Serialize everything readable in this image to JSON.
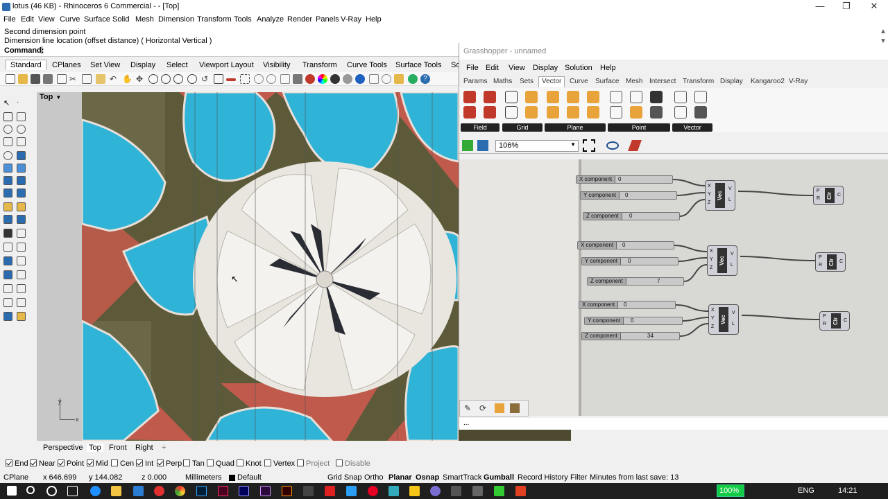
{
  "window": {
    "title": "lotus (46 KB) - Rhinoceros 6 Commercial - - [Top]",
    "minimize": "—",
    "maximize": "❐",
    "close": "✕"
  },
  "menu": [
    "File",
    "Edit",
    "View",
    "Curve",
    "Surface",
    "Solid",
    "Mesh",
    "Dimension",
    "Transform",
    "Tools",
    "Analyze",
    "Render",
    "Panels",
    "V-Ray",
    "Help"
  ],
  "command": {
    "line1": "Second dimension point",
    "line2": "Dimension line location (offset distance) ( Horizontal  Vertical )",
    "prompt": "Command:"
  },
  "command_tabs": [
    "Standard",
    "CPlanes",
    "Set View",
    "Display",
    "Select",
    "Viewport Layout",
    "Visibility",
    "Transform",
    "Curve Tools",
    "Surface Tools",
    "So"
  ],
  "viewport": {
    "label": "Top",
    "axis_x": "x",
    "axis_y": "y"
  },
  "view_tabs": [
    "Perspective",
    "Top",
    "Front",
    "Right"
  ],
  "view_tabs_add": "+",
  "osnap": [
    {
      "label": "End",
      "on": true
    },
    {
      "label": "Near",
      "on": true
    },
    {
      "label": "Point",
      "on": true
    },
    {
      "label": "Mid",
      "on": true
    },
    {
      "label": "Cen",
      "on": false
    },
    {
      "label": "Int",
      "on": true
    },
    {
      "label": "Perp",
      "on": true
    },
    {
      "label": "Tan",
      "on": false
    },
    {
      "label": "Quad",
      "on": false
    },
    {
      "label": "Knot",
      "on": false
    },
    {
      "label": "Vertex",
      "on": false
    },
    {
      "label": "Project",
      "on": false
    },
    {
      "label": "Disable",
      "on": false
    }
  ],
  "status": {
    "cplane": "CPlane",
    "x": "x 646.699",
    "y": "y 144.082",
    "z": "z 0.000",
    "units": "Millimeters",
    "layer": "Default",
    "grid_snap": "Grid Snap",
    "ortho": "Ortho",
    "planar": "Planar",
    "osnap": "Osnap",
    "smarttrack": "SmartTrack",
    "gumball": "Gumball",
    "record": "Record History",
    "filter": "Filter",
    "minutes": "Minutes from last save: 13"
  },
  "taskbar": {
    "battery": "100%",
    "lang": "ENG",
    "time": "14:21"
  },
  "gh": {
    "title": "Grasshopper - unnamed",
    "menu": [
      "File",
      "Edit",
      "View",
      "Display",
      "Solution",
      "Help"
    ],
    "tabs": [
      "Params",
      "Maths",
      "Sets",
      "Vector",
      "Curve",
      "Surface",
      "Mesh",
      "Intersect",
      "Transform",
      "Display",
      "Kangaroo2",
      "V-Ray"
    ],
    "active_tab": "Vector",
    "groups": [
      "Field",
      "Grid",
      "Plane",
      "Point",
      "Vector"
    ],
    "zoom": "106%",
    "status": "...",
    "rows": [
      {
        "x": {
          "label": "X component",
          "value": "0"
        },
        "y": {
          "label": "Y component",
          "value": "0"
        },
        "z": {
          "label": "Z component",
          "value": "0"
        }
      },
      {
        "x": {
          "label": "X component",
          "value": "0"
        },
        "y": {
          "label": "Y component",
          "value": "0"
        },
        "z": {
          "label": "Z component",
          "value": "7"
        }
      },
      {
        "x": {
          "label": "X component",
          "value": "0"
        },
        "y": {
          "label": "Y component",
          "value": "0"
        },
        "z": {
          "label": "Z component",
          "value": "34"
        }
      }
    ],
    "vec_label": "Vec",
    "clr_label": "Clr",
    "vec_in": [
      "X",
      "Y",
      "Z"
    ],
    "vec_out": [
      "V",
      "L"
    ],
    "clr_in": [
      "P",
      "R"
    ],
    "clr_out": "C"
  }
}
